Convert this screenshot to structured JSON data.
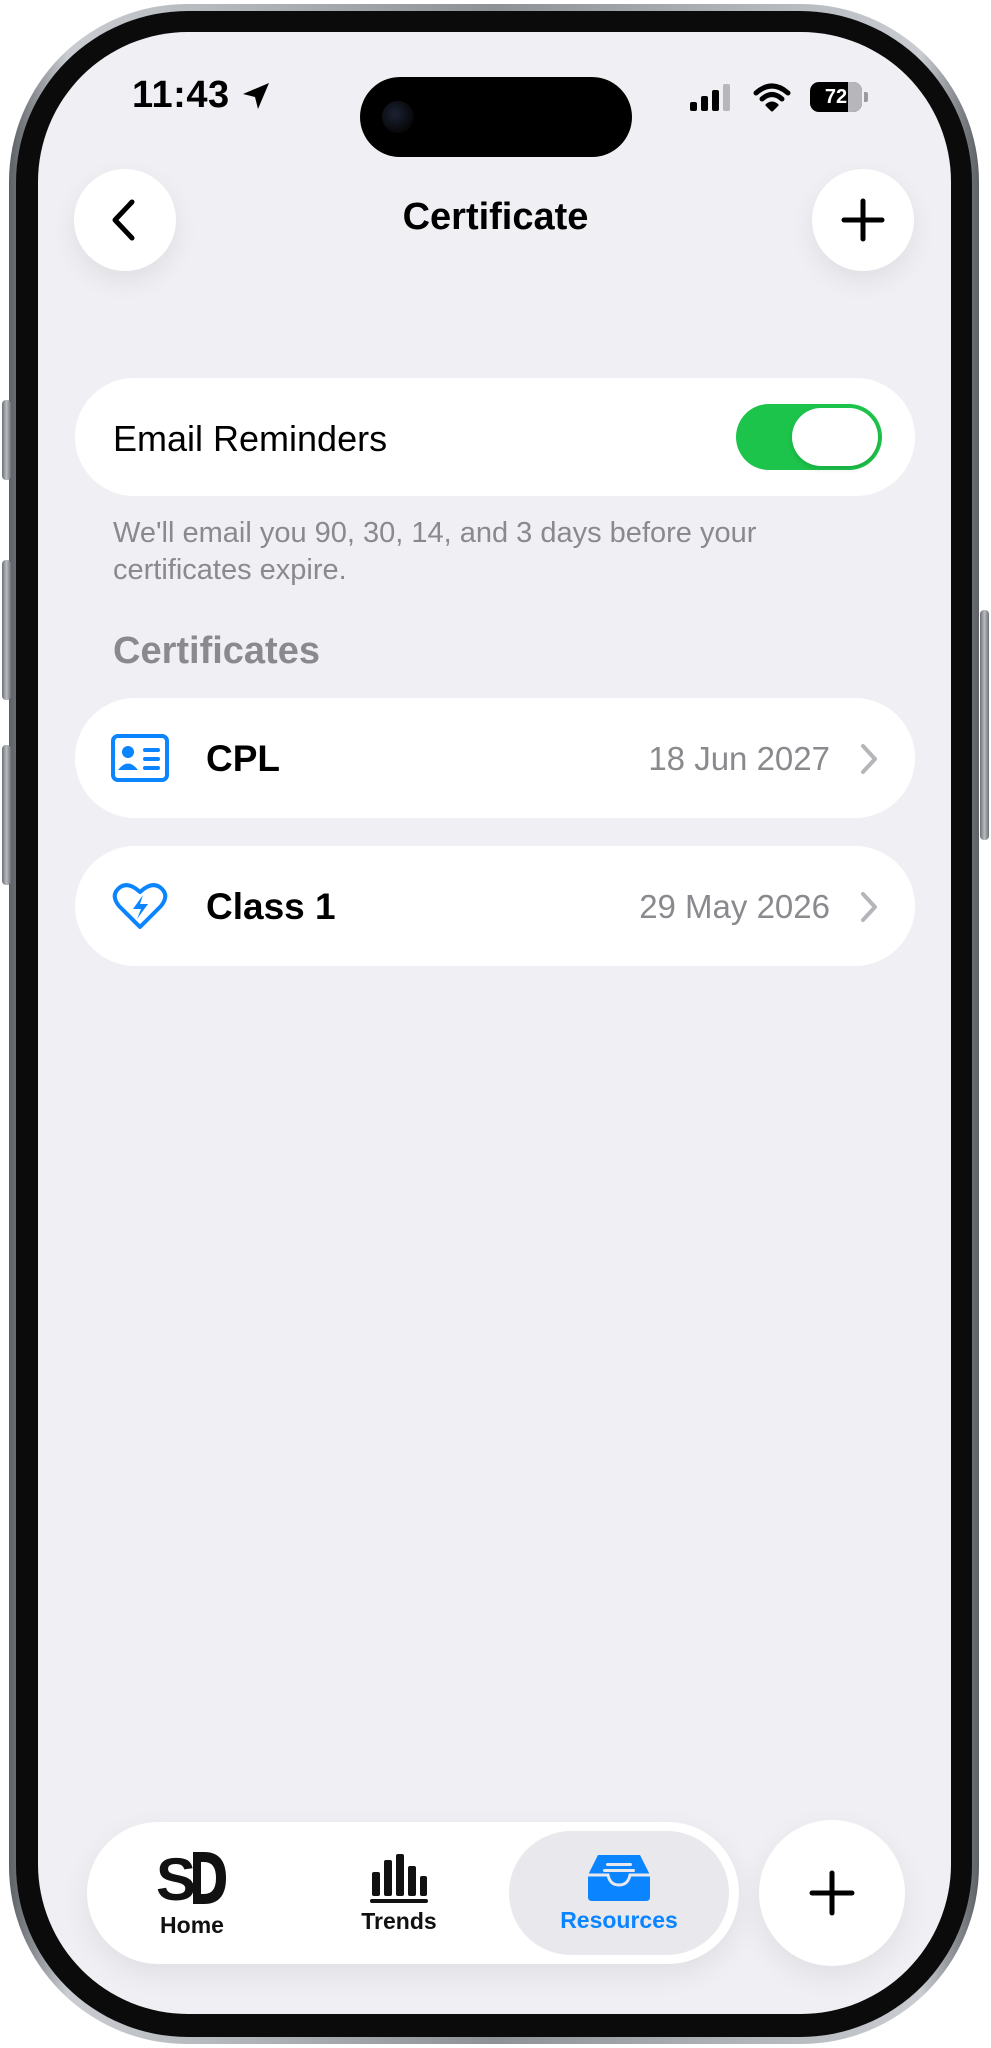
{
  "status_bar": {
    "time": "11:43",
    "battery": "72"
  },
  "header": {
    "title": "Certificate"
  },
  "email_reminders": {
    "label": "Email Reminders",
    "enabled": true,
    "note": "We'll email you 90, 30, 14, and 3 days before your certificates expire."
  },
  "certificates": {
    "heading": "Certificates",
    "items": [
      {
        "name": "CPL",
        "date": "18 Jun 2027",
        "icon": "id-card-icon"
      },
      {
        "name": "Class 1",
        "date": "29 May 2026",
        "icon": "heart-bolt-icon"
      }
    ]
  },
  "tabbar": {
    "tabs": [
      {
        "label": "Home",
        "icon": "sd-logo-icon",
        "active": false
      },
      {
        "label": "Trends",
        "icon": "bar-chart-icon",
        "active": false
      },
      {
        "label": "Resources",
        "icon": "tray-icon",
        "active": true
      }
    ]
  },
  "colors": {
    "accent": "#0a84ff",
    "toggle_on": "#1dc44b",
    "background": "#f0f0f4",
    "secondary_text": "#8a8a8e"
  }
}
